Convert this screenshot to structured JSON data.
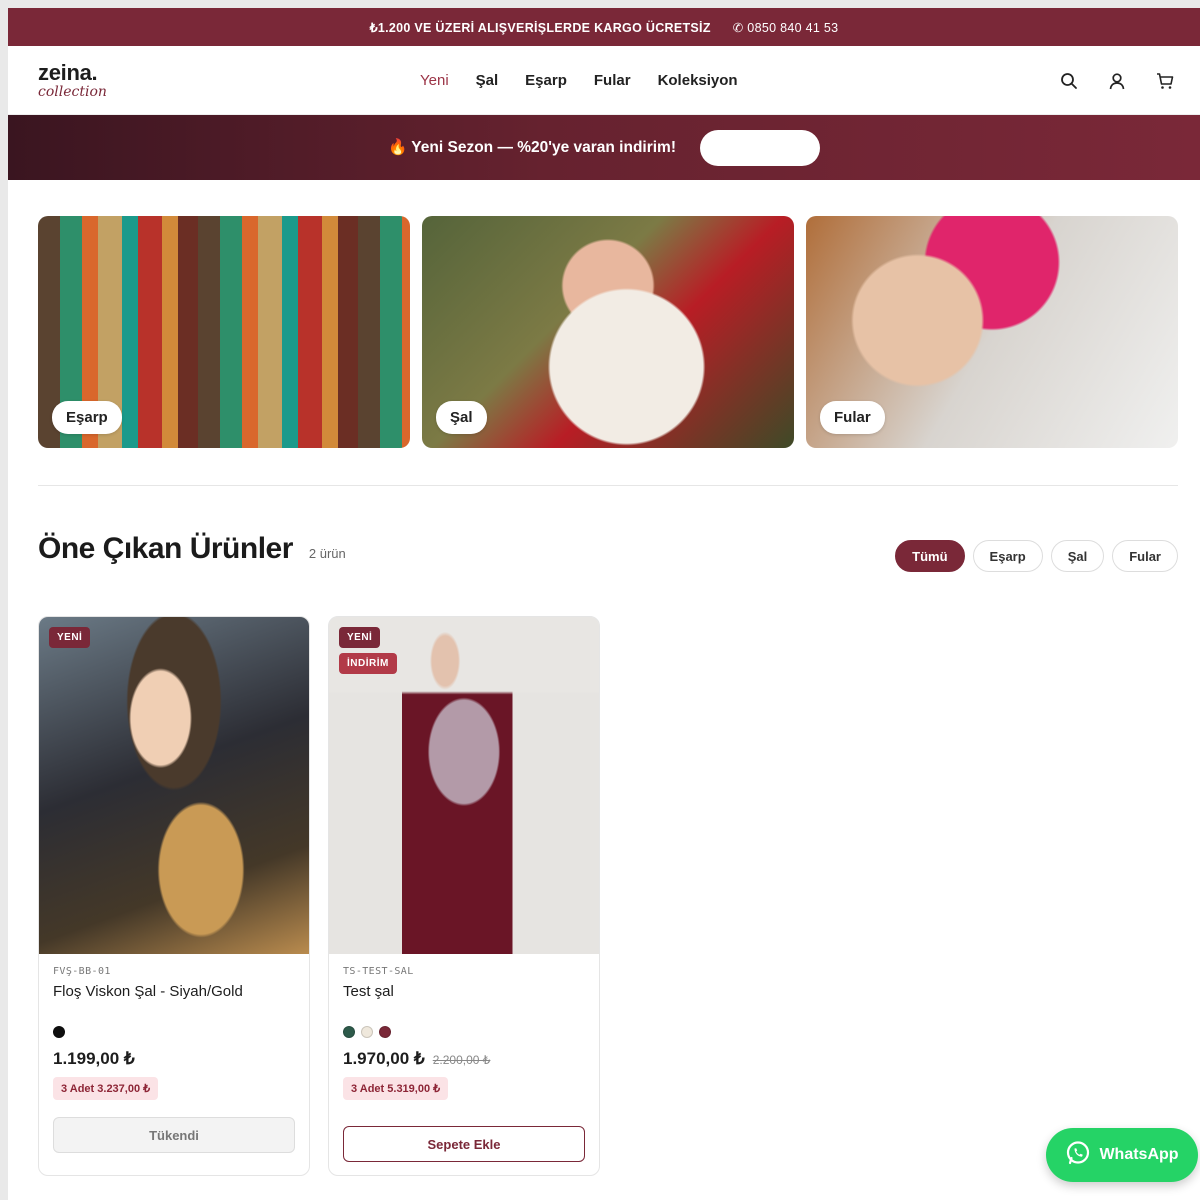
{
  "topbar": {
    "shipping": "₺1.200 VE ÜZERİ ALIŞVERİŞLERDE KARGO ÜCRETSİZ",
    "phone": "✆ 0850 840 41 53"
  },
  "header": {
    "logo_brand": "zeina.",
    "logo_sub": "collection",
    "nav": [
      "Yeni",
      "Şal",
      "Eşarp",
      "Fular",
      "Koleksiyon"
    ],
    "icons": [
      "search-icon",
      "user-icon",
      "cart-icon"
    ]
  },
  "promo": {
    "text": "🔥 Yeni Sezon — %20'ye varan indirim!",
    "button_label": ""
  },
  "categories": [
    {
      "label": "Eşarp"
    },
    {
      "label": "Şal"
    },
    {
      "label": "Fular"
    }
  ],
  "featured": {
    "title": "Öne Çıkan Ürünler",
    "count": "2 ürün",
    "filters": [
      "Tümü",
      "Eşarp",
      "Şal",
      "Fular"
    ],
    "active_filter": "Tümü"
  },
  "products": [
    {
      "badges": [
        "YENİ"
      ],
      "sku": "FVŞ-BB-01",
      "name": "Floş Viskon Şal - Siyah/Gold",
      "colors": [
        "#0e0e0e"
      ],
      "price": "1.199,00 ₺",
      "old_price": "",
      "bundle": "3 Adet 3.237,00 ₺",
      "button": "Tükendi"
    },
    {
      "badges": [
        "YENİ",
        "İNDİRİM"
      ],
      "sku": "TS-TEST-SAL",
      "name": "Test şal",
      "colors": [
        "#2d5a4a",
        "#efe8dc",
        "#7a2838"
      ],
      "price": "1.970,00 ₺",
      "old_price": "2.200,00 ₺",
      "bundle": "3 Adet 5.319,00 ₺",
      "button": "Sepete Ekle"
    }
  ],
  "whatsapp": {
    "label": "WhatsApp"
  },
  "colors": {
    "brand": "#7a2838",
    "whatsapp": "#25d366"
  }
}
